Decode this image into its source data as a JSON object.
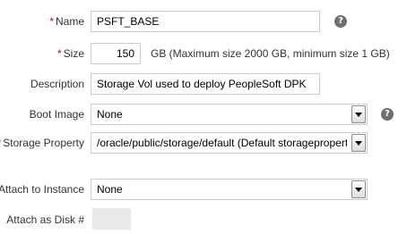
{
  "form": {
    "name": {
      "label": "Name",
      "value": "PSFT_BASE",
      "required": true
    },
    "size": {
      "label": "Size",
      "value": "150",
      "hint": "GB (Maximum size 2000 GB, minimum size 1 GB)",
      "required": true
    },
    "description": {
      "label": "Description",
      "value": "Storage Vol used to deploy PeopleSoft DPK"
    },
    "boot_image": {
      "label": "Boot Image",
      "value": "None"
    },
    "storage_property": {
      "label": "Storage Property",
      "value": "/oracle/public/storage/default (Default storageproperty f",
      "required": true
    },
    "attach_to_instance": {
      "label": "Attach to Instance",
      "value": "None"
    },
    "attach_as_disk": {
      "label": "Attach as Disk #",
      "value": ""
    }
  },
  "required_marker": "*",
  "icons": {
    "help": "help-icon",
    "dropdown": "chevron-down-icon",
    "help_glyph": "?"
  },
  "colors": {
    "required_marker": "#cc0000",
    "input_border": "#c4ced7",
    "disabled_bg": "#e9e9e9",
    "help_icon_bg": "#6f6f6f"
  }
}
